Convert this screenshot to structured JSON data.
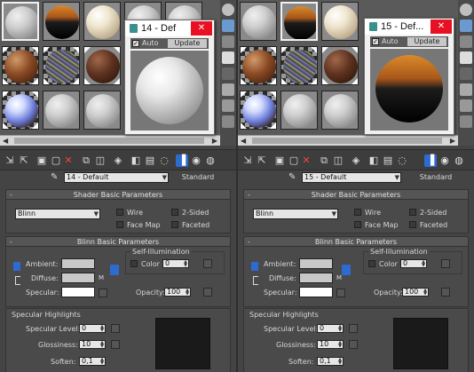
{
  "panes": [
    {
      "window": {
        "title": "14 - Default",
        "close": "✕",
        "auto_label": "Auto",
        "update_label": "Update"
      },
      "material_name": "14 - Default",
      "material_type": "Standard",
      "shader_section": {
        "title": "Shader Basic Parameters",
        "shader": "Blinn",
        "wire": "Wire",
        "two_sided": "2-Sided",
        "face_map": "Face Map",
        "faceted": "Faceted"
      },
      "blinn_section": {
        "title": "Blinn Basic Parameters",
        "self_illum_label": "Self-Illumination",
        "color_label": "Color",
        "color_value": "0",
        "ambient": "Ambient:",
        "diffuse": "Diffuse:",
        "specular": "Specular:",
        "m_label": "M",
        "opacity_label": "Opacity:",
        "opacity_value": "100"
      },
      "highlights": {
        "title": "Specular Highlights",
        "level_label": "Specular Level:",
        "level_value": "0",
        "gloss_label": "Glossiness:",
        "gloss_value": "10",
        "soften_label": "Soften:",
        "soften_value": "0,1"
      }
    },
    {
      "window": {
        "title": "15 - Def...",
        "close": "✕",
        "auto_label": "Auto",
        "update_label": "Update"
      },
      "material_name": "15 - Default",
      "material_type": "Standard",
      "shader_section": {
        "title": "Shader Basic Parameters",
        "shader": "Blinn",
        "wire": "Wire",
        "two_sided": "2-Sided",
        "face_map": "Face Map",
        "faceted": "Faceted"
      },
      "blinn_section": {
        "title": "Blinn Basic Parameters",
        "self_illum_label": "Self-Illumination",
        "color_label": "Color",
        "color_value": "0",
        "ambient": "Ambient:",
        "diffuse": "Diffuse:",
        "specular": "Specular:",
        "m_label": "M",
        "opacity_label": "Opacity:",
        "opacity_value": "100"
      },
      "highlights": {
        "title": "Specular Highlights",
        "level_label": "Specular Level:",
        "level_value": "0",
        "gloss_label": "Glossiness:",
        "gloss_value": "10",
        "soften_label": "Soften:",
        "soften_value": "0,1"
      }
    }
  ],
  "left_window_title": "14 - Def",
  "right_window_title": "15 - Def...",
  "rollout_minus": "-",
  "icons": {
    "close": "close-icon",
    "dropdown": "chevron-down-icon",
    "eyedropper": "eyedropper-icon",
    "delete": "delete-icon",
    "spinner": "spinner-arrows-icon",
    "lock": "lock-icon"
  },
  "colors": {
    "accent_blue": "#2e6bd0",
    "close_red": "#e81123",
    "delete_red": "#ee4444",
    "panel_bg": "#444444"
  }
}
